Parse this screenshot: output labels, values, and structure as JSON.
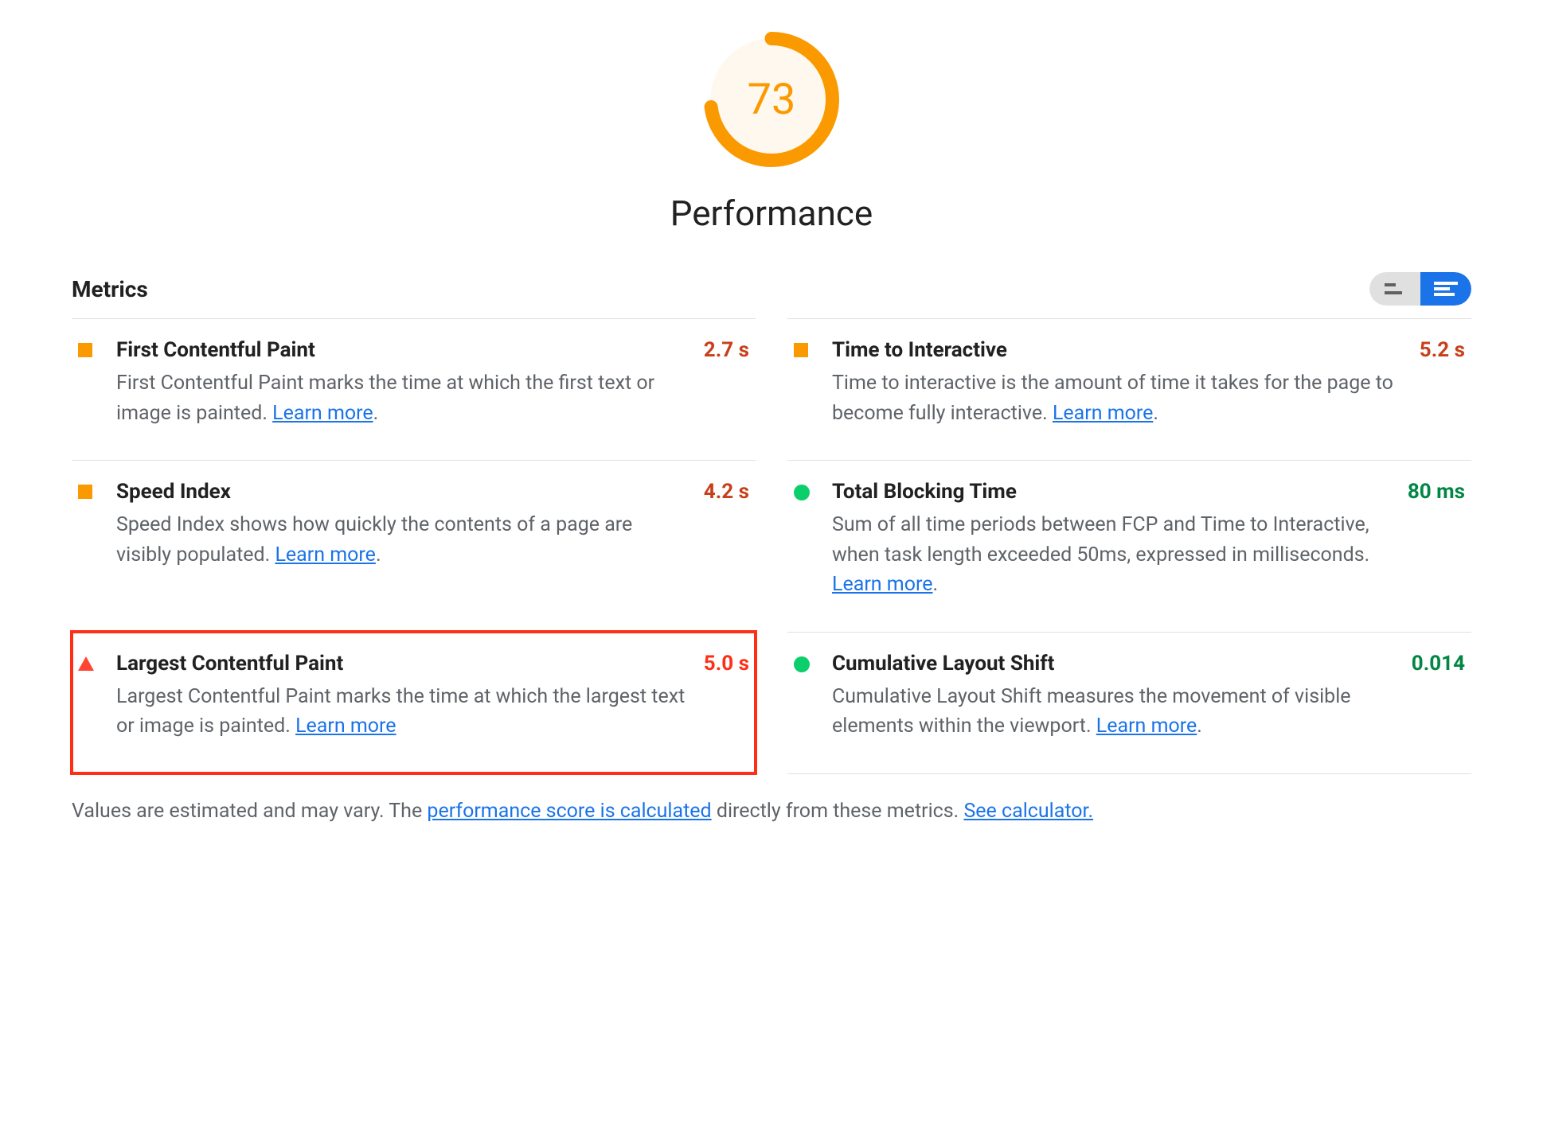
{
  "gauge": {
    "score": 73,
    "title": "Performance",
    "color": "#fa9a00"
  },
  "metrics_label": "Metrics",
  "learn_more": "Learn more",
  "columns": {
    "left": [
      {
        "icon": "square",
        "value_class": "val-orange",
        "highlight": false,
        "title": "First Contentful Paint",
        "desc_pre": "First Contentful Paint marks the time at which the first text or image is painted. ",
        "value": "2.7 s",
        "trailing_period": true
      },
      {
        "icon": "square",
        "value_class": "val-orange",
        "highlight": false,
        "title": "Speed Index",
        "desc_pre": "Speed Index shows how quickly the contents of a page are visibly populated. ",
        "value": "4.2 s",
        "trailing_period": true
      },
      {
        "icon": "triangle",
        "value_class": "val-red",
        "highlight": true,
        "title": "Largest Contentful Paint",
        "desc_pre": "Largest Contentful Paint marks the time at which the largest text or image is painted. ",
        "value": "5.0 s",
        "trailing_period": false
      }
    ],
    "right": [
      {
        "icon": "square",
        "value_class": "val-orange",
        "highlight": false,
        "title": "Time to Interactive",
        "desc_pre": "Time to interactive is the amount of time it takes for the page to become fully interactive. ",
        "value": "5.2 s",
        "trailing_period": true
      },
      {
        "icon": "circle",
        "value_class": "val-green",
        "highlight": false,
        "title": "Total Blocking Time",
        "desc_pre": "Sum of all time periods between FCP and Time to Interactive, when task length exceeded 50ms, expressed in milliseconds. ",
        "value": "80 ms",
        "trailing_period": true
      },
      {
        "icon": "circle",
        "value_class": "val-green",
        "highlight": false,
        "title": "Cumulative Layout Shift",
        "desc_pre": "Cumulative Layout Shift measures the movement of visible elements within the viewport. ",
        "value": "0.014",
        "trailing_period": true
      }
    ]
  },
  "footer": {
    "text_pre": "Values are estimated and may vary. The ",
    "link1": "performance score is calculated",
    "text_mid": " directly from these metrics. ",
    "link2": "See calculator."
  }
}
